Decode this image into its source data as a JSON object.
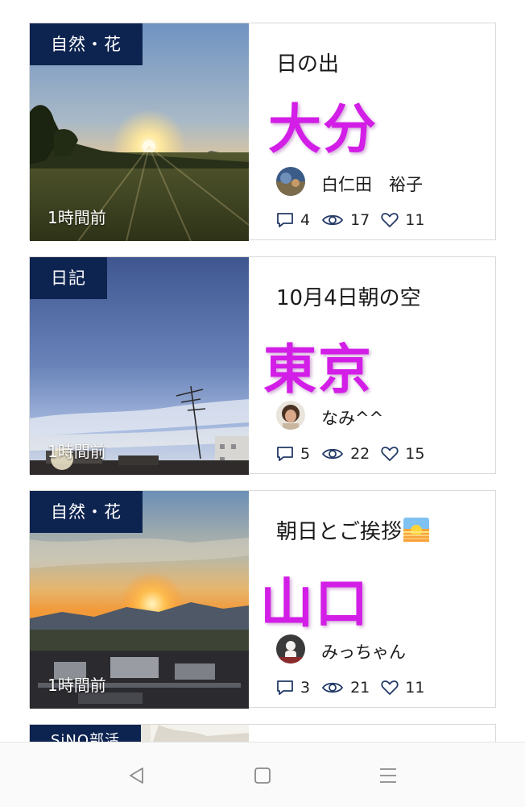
{
  "posts": [
    {
      "category": "自然・花",
      "time_ago": "1時間前",
      "title": "日の出",
      "place": "大分",
      "author": "白仁田　裕子",
      "comments": "4",
      "views": "17",
      "likes": "11"
    },
    {
      "category": "日記",
      "time_ago": "1時間前",
      "title": "10月4日朝の空",
      "place": "東京",
      "author": "なみ^^",
      "comments": "5",
      "views": "22",
      "likes": "15"
    },
    {
      "category": "自然・花",
      "time_ago": "1時間前",
      "title": "朝日とご挨拶",
      "place": "山口",
      "author": "みっちゃん",
      "comments": "3",
      "views": "21",
      "likes": "11"
    },
    {
      "category": "SiNQ部活"
    }
  ],
  "icons": {
    "comment": "comment-icon",
    "views": "eye-icon",
    "likes": "heart-icon",
    "back": "back-triangle-icon",
    "home": "home-square-icon",
    "menu": "menu-lines-icon"
  },
  "colors": {
    "tag_bg": "#0e2450",
    "place_text": "#d21ee6"
  }
}
